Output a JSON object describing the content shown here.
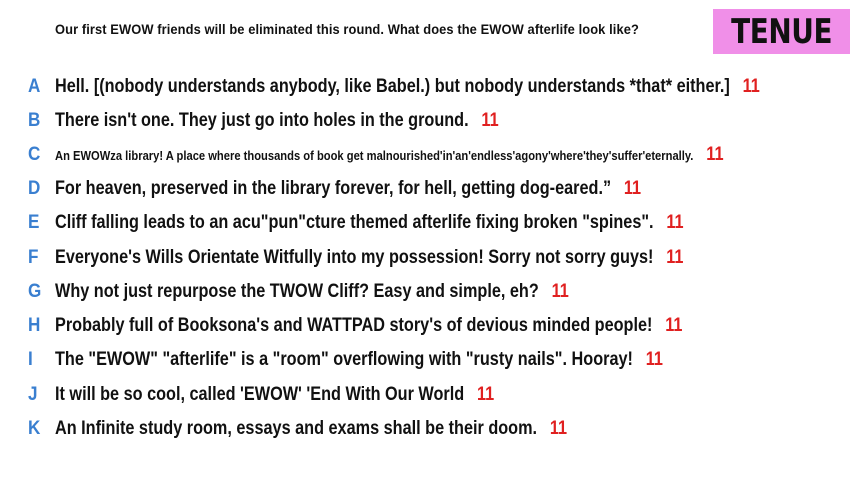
{
  "prompt": "Our first EWOW friends will be eliminated this round. What does the EWOW afterlife look like?",
  "tag": "TENUE",
  "responses": [
    {
      "letter": "A",
      "text": "Hell. [(nobody understands anybody, like Babel.) but nobody understands *that* either.]",
      "votes": "11"
    },
    {
      "letter": "B",
      "text": "There isn't one. They just go into holes in the ground.",
      "votes": "11"
    },
    {
      "letter": "C",
      "text": "An EWOWza library! A place where thousands of book get malnourished'in'an'endless'agony'where'they'suffer'eternally.",
      "votes": "11"
    },
    {
      "letter": "D",
      "text": "For heaven, preserved in the library forever, for hell, getting dog-eared.”",
      "votes": "11"
    },
    {
      "letter": "E",
      "text": "Cliff falling leads to an acu\"pun\"cture themed afterlife fixing broken \"spines\".",
      "votes": "11"
    },
    {
      "letter": "F",
      "text": "Everyone's Wills Orientate Witfully into my possession!  Sorry not sorry guys!",
      "votes": "11"
    },
    {
      "letter": "G",
      "text": "Why not just repurpose the TWOW Cliff? Easy and simple, eh?",
      "votes": "11"
    },
    {
      "letter": "H",
      "text": "Probably full of Booksona's and WATTPAD story's of devious minded people!",
      "votes": "11"
    },
    {
      "letter": "I",
      "text": "The \"EWOW\" \"afterlife\" is a \"room\" overflowing with \"rusty nails\". Hooray!",
      "votes": "11"
    },
    {
      "letter": "J",
      "text": "It will be so cool, called 'EWOW' 'End With Our World",
      "votes": "11"
    },
    {
      "letter": "K",
      "text": "An Infinite study room, essays and exams shall be their doom.",
      "votes": "11"
    }
  ]
}
